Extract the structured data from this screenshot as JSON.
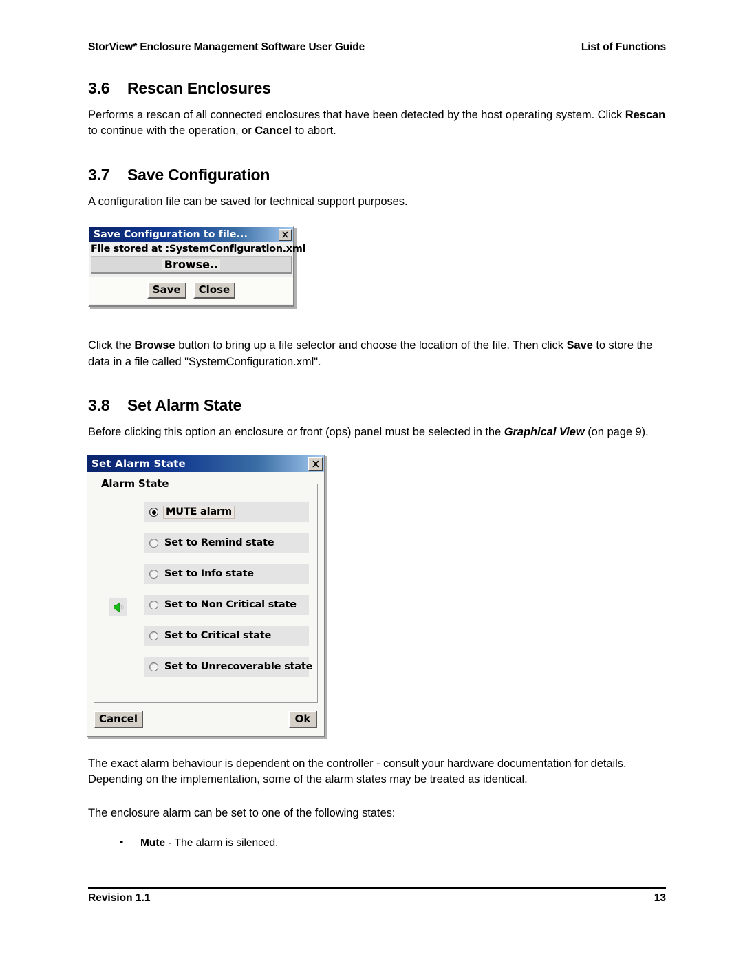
{
  "header": {
    "left": "StorView* Enclosure Management Software User Guide",
    "right": "List of Functions"
  },
  "sections": {
    "rescan": {
      "number": "3.6",
      "title": "Rescan Enclosures",
      "para_1a": "Performs a rescan of all connected enclosures that have been detected by the host operating system. Click ",
      "para_1b": "Rescan",
      "para_1c": " to continue with the operation, or ",
      "para_1d": "Cancel",
      "para_1e": " to abort."
    },
    "save_config": {
      "number": "3.7",
      "title": "Save Configuration",
      "intro": "A configuration file can be saved for technical support purposes.",
      "after_1a": "Click the ",
      "after_1b": "Browse",
      "after_1c": " button to bring up a file selector and choose the location of the file. Then click ",
      "after_1d": "Save",
      "after_1e": " to store the data in a file called \"SystemConfiguration.xml\"."
    },
    "set_alarm": {
      "number": "3.8",
      "title": "Set Alarm State",
      "intro_a": "Before clicking this option an enclosure or front (ops) panel must be selected in the ",
      "intro_b": "Graphical View",
      "intro_c": " (on page 9).",
      "note": "The exact alarm behaviour is dependent on the controller - consult your hardware documentation for details. Depending on the implementation, some of the alarm states may be treated as identical.",
      "list_intro": "The enclosure alarm can be set to one of the following states:",
      "bullets": [
        {
          "term": "Mute",
          "desc": " - The alarm is silenced."
        }
      ]
    }
  },
  "dialog_save_config": {
    "title": "Save Configuration to file...",
    "close_icon": "close-icon",
    "file_stored_label": "File stored at :SystemConfiguration.xml",
    "browse_button": "Browse..",
    "save_button": "Save",
    "close_button": "Close"
  },
  "dialog_set_alarm": {
    "title": "Set Alarm State",
    "close_icon": "close-icon",
    "groupbox_legend": "Alarm State",
    "speaker_icon": "speaker-icon",
    "options": [
      {
        "label": "MUTE alarm",
        "selected": true,
        "focused": true
      },
      {
        "label": "Set to Remind state",
        "selected": false,
        "focused": false
      },
      {
        "label": "Set to Info state",
        "selected": false,
        "focused": false
      },
      {
        "label": "Set to Non Critical state",
        "selected": false,
        "focused": false
      },
      {
        "label": "Set to Critical state",
        "selected": false,
        "focused": false
      },
      {
        "label": "Set to Unrecoverable state",
        "selected": false,
        "focused": false
      }
    ],
    "cancel_button": "Cancel",
    "ok_button": "Ok"
  },
  "footer": {
    "revision": "Revision 1.1",
    "page": "13"
  },
  "colors": {
    "titlebar_dark": "#0a246a",
    "titlebar_light": "#a6caf0",
    "dialog_face": "#d4d0c8",
    "radio_row": "#e4e4e4",
    "speaker_green": "#17bd17"
  }
}
